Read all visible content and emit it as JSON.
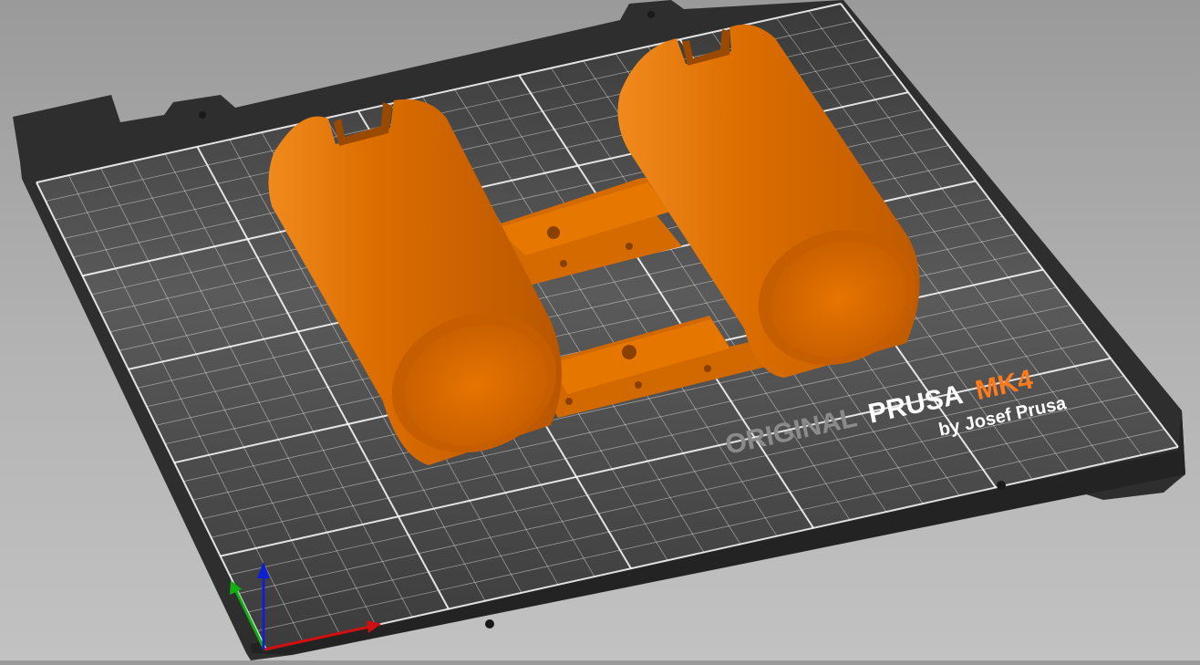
{
  "viewport": {
    "printer_brand_prefix": "ORIGINAL",
    "printer_brand_name": "PRUSA",
    "printer_model": "MK4",
    "printer_byline": "by Josef Prusa",
    "bed_model": "Prusa MK4 print bed",
    "object_name": "dual-tube holder",
    "colors": {
      "background_top": "#9a9a9a",
      "background_bottom": "#c2c2c2",
      "bed_frame": "#2e2e2e",
      "bed_surface": "#4a4a4a",
      "grid_line": "#ffffff",
      "model_orange": "#e07000",
      "logo_orange": "#ff7a1a",
      "axis_x": "#d01010",
      "axis_y": "#10b010",
      "axis_z": "#1020d0"
    },
    "axes": {
      "x_label": "x-axis",
      "y_label": "y-axis",
      "z_label": "z-axis"
    }
  }
}
